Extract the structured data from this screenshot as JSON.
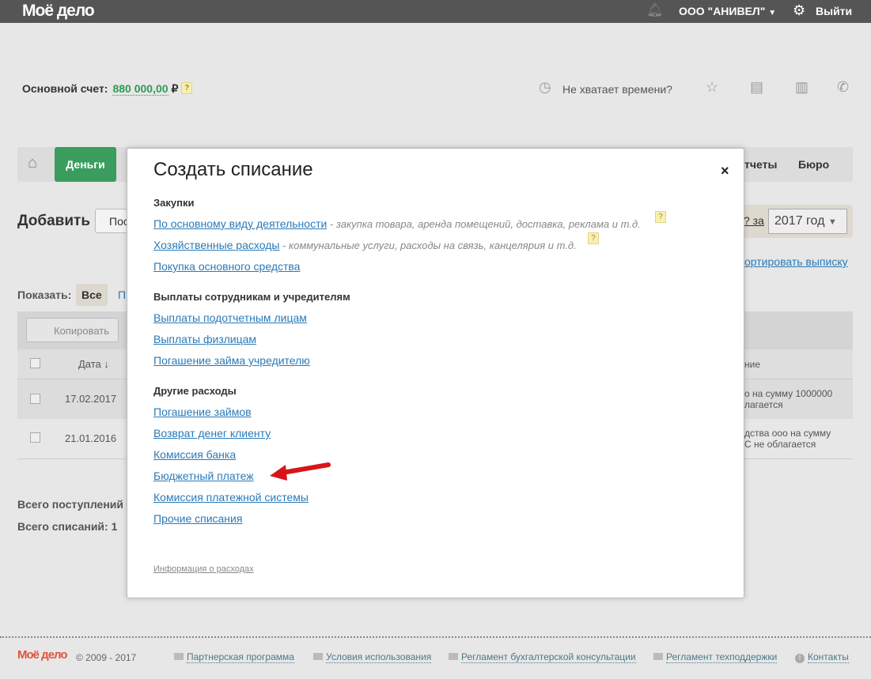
{
  "header": {
    "logo": "Моё дело",
    "company": "ООО \"АНИВЕЛ\"",
    "logout": "Выйти"
  },
  "account": {
    "label": "Основной счет:",
    "amount": "880 000,00",
    "currency": "₽",
    "help": "?",
    "no_time": "Не хватает времени?"
  },
  "nav": {
    "money": "Деньги",
    "reports": "тчеты",
    "bureau": "Бюро"
  },
  "toolbar": {
    "add": "Добавить",
    "add_btn": "Пос",
    "period_link": "? за",
    "year": "2017 год",
    "import": "ортировать выписку",
    "show_label": "Показать:",
    "show_all": "Все",
    "show_other": "П",
    "copy": "Копировать"
  },
  "table": {
    "col_date": "Дата ↓",
    "col_desc": "ние",
    "rows": [
      {
        "date": "17.02.2017",
        "desc1": "о на сумму 1000000",
        "desc2": "лагается"
      },
      {
        "date": "21.01.2016",
        "desc1": "дства ооо на сумму",
        "desc2": "С не облагается"
      }
    ]
  },
  "totals": {
    "income": "Всего поступлений",
    "expense": "Всего списаний: 1"
  },
  "modal": {
    "title": "Создать списание",
    "close": "×",
    "sections": [
      {
        "title": "Закупки",
        "items": [
          {
            "label": "По основному виду деятельности",
            "desc": " - закупка товара, аренда помещений, доставка, реклама и т.д.",
            "help": "?"
          },
          {
            "label": "Хозяйственные расходы",
            "desc": " - коммунальные услуги, расходы на связь, канцелярия и т.д.",
            "help": "?"
          },
          {
            "label": "Покупка основного средства"
          }
        ]
      },
      {
        "title": "Выплаты сотрудникам и учредителям",
        "items": [
          {
            "label": "Выплаты подотчетным лицам"
          },
          {
            "label": "Выплаты физлицам"
          },
          {
            "label": "Погашение займа учредителю"
          }
        ]
      },
      {
        "title": "Другие расходы",
        "items": [
          {
            "label": "Погашение займов"
          },
          {
            "label": "Возврат денег клиенту"
          },
          {
            "label": "Комиссия банка"
          },
          {
            "label": "Бюджетный платеж"
          },
          {
            "label": "Комиссия платежной системы"
          },
          {
            "label": "Прочие списания"
          }
        ]
      }
    ],
    "info": "Информация о расходах"
  },
  "footer": {
    "logo": "Моё дело",
    "copyright": "© 2009 - 2017",
    "links": [
      "Партнерская программа",
      "Условия использования",
      "Регламент бухгалтерской консультации",
      "Регламент техподдержки",
      "Контакты"
    ]
  }
}
